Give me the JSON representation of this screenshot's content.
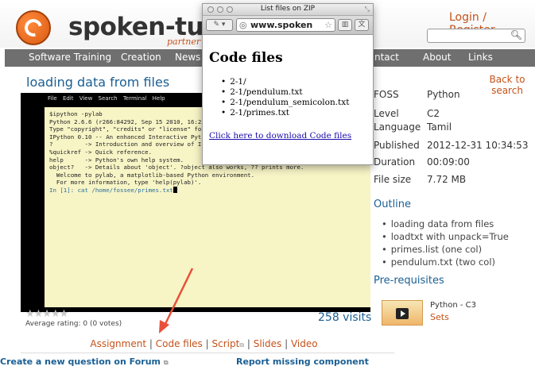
{
  "header": {
    "brand": "spoken-tuto",
    "brand_sub": "partner w",
    "login_text": "Login / Register"
  },
  "nav": {
    "items": [
      "Software Training",
      "Creation",
      "News &",
      "ntact",
      "About",
      "Links"
    ]
  },
  "page_title": "loading data from files",
  "back_link": "Back to search",
  "video": {
    "menu": "File Edit View Search Terminal Help",
    "lines": [
      "$ipython -pylab",
      "Python 2.6.6 (r266:84292, Sep 15 2010, 16:22",
      "Type \"copyright\", \"credits\" or \"license\" for",
      "",
      "IPython 0.10 -- An enhanced Interactive Pyth",
      "?         -> Introduction and overview of IP",
      "%quickref -> Quick reference.",
      "help      -> Python's own help system.",
      "object?   -> Details about 'object'. ?object also works, ?? prints more.",
      "",
      "  Welcome to pylab, a matplotlib-based Python environment.",
      "  For more information, type 'help(pylab)'.",
      ""
    ],
    "prompt": "In [1]: cat /home/fossee/primes.txt"
  },
  "rating": {
    "stars": "★★★★★",
    "text": "Average rating: 0 (0 votes)"
  },
  "visits": "258 visits",
  "links": {
    "assignment": "Assignment",
    "code_files": "Code files",
    "script": "Script",
    "slides": "Slides",
    "video": "Video",
    "separator": "|"
  },
  "forum_link": "Create a new question on Forum",
  "report_link": "Report missing component",
  "info": [
    {
      "key": "FOSS",
      "value": "Python"
    },
    {
      "key": "Level",
      "value": "C2"
    },
    {
      "key": "Language",
      "value": "Tamil"
    },
    {
      "key": "Published",
      "value": "2012-12-31 10:34:53"
    },
    {
      "key": "Duration",
      "value": "00:09:00"
    },
    {
      "key": "File size",
      "value": "7.72 MB"
    }
  ],
  "outline": {
    "title": "Outline",
    "items": [
      "loading data from files",
      "loadtxt with unpack=True",
      "primes.list (one col)",
      "pendulum.txt (two col)"
    ]
  },
  "prerequisites": {
    "title": "Pre-requisites",
    "item_title": "Python - C3",
    "item_sub": "Sets"
  },
  "popup": {
    "title": "List files on ZIP",
    "url": "www.spoken",
    "heading": "Code files",
    "files": [
      "2-1/",
      "2-1/pendulum.txt",
      "2-1/pendulum_semicolon.txt",
      "2-1/primes.txt"
    ],
    "download_link": "Click here to download Code files"
  },
  "colors": {
    "brand_orange": "#c4521a",
    "link_blue": "#1a5f94",
    "nav_gray": "#6f6f6f",
    "annotation_arrow": "#e8503a"
  }
}
